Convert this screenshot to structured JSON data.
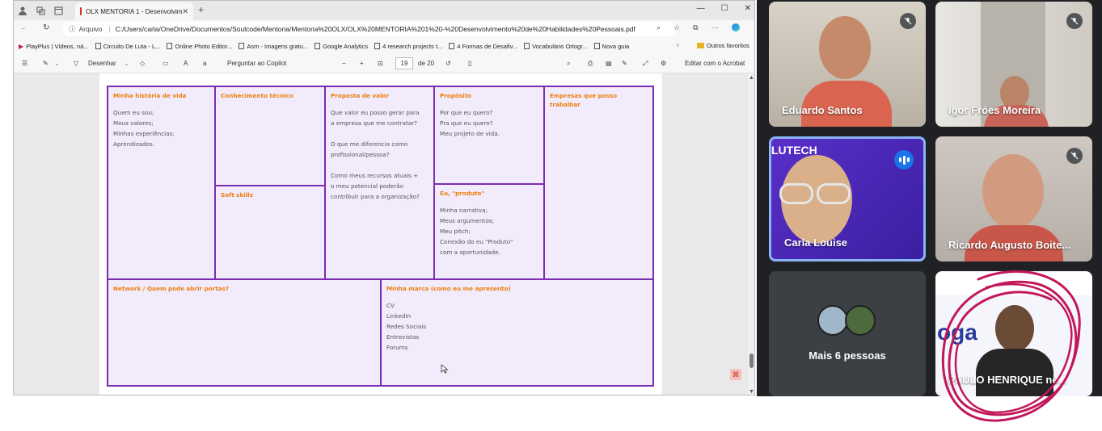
{
  "browser": {
    "tab_title": "OLX MENTORIA 1 - Desenvolvim",
    "address_prefix": "Arquivo",
    "url": "C:/Users/carla/OneDrive/Documentos/Soulcode/Mentoria/Mentoria%20OLX/OLX%20MENTORIA%201%20-%20Desenvolvimento%20de%20Habilidades%20Pessoais.pdf",
    "favorites": [
      "PlayPlus | Vídeos, ná...",
      "Circuito De Luta - L...",
      "Online Photo Editor...",
      "Asm - Imagens gratu...",
      "Google Analytics",
      "4 research projects t...",
      "4 Formas de Desafiv...",
      "Vocabulário Ortogr...",
      "Nova guia"
    ],
    "favorites_other": "Outros favoritos"
  },
  "pdf_toolbar": {
    "draw_label": "Desenhar",
    "copilot_label": "Perguntar ao Copilot",
    "page_current": "19",
    "page_total": "de 20",
    "acrobat_label": "Editar com o Acrobat"
  },
  "canvas": {
    "historia": {
      "title": "Minha história de vida",
      "lines": [
        "Quem eu sou;",
        "Meus valores;",
        "Minhas experiências;",
        "Aprendizados."
      ]
    },
    "conhecimento": {
      "title": "Conhecimento técnico"
    },
    "soft": {
      "title": "Soft skills"
    },
    "proposta": {
      "title": "Proposta de valor",
      "l1": "Que valor eu posso gerar para",
      "l2": "a empresa que me contratar?",
      "l3": "O que me diferencia como",
      "l4": "profissional/pessoa?",
      "l5": "Como meus recursos atuais +",
      "l6": "o meu potencial poderão",
      "l7": "contribuir para a organização?"
    },
    "proposito": {
      "title": "Propósito",
      "lines": [
        "Por que eu quero?",
        "Pra que eu quero?",
        "Meu projeto de vida."
      ]
    },
    "produto": {
      "title": "Eu, \"produto\"",
      "lines": [
        "Minha narrativa;",
        "Meus argumentos;",
        "Meu pitch;",
        "Conexão do eu \"Produto\"",
        "com a oportunidade."
      ]
    },
    "empresas": {
      "title": "Empresas que posso trabalhar"
    },
    "network": {
      "title": "Network / Quem pode abrir portas?"
    },
    "marca": {
      "title": "Minha marca (como eu me apresento)",
      "lines": [
        "CV",
        "LinkedIn",
        "Redes Sociais",
        "Entrevistas",
        "Forums"
      ]
    }
  },
  "meet": {
    "participants": [
      {
        "name": "Eduardo Santos",
        "muted": true
      },
      {
        "name": "Igor Fróes Moreira",
        "muted": true
      },
      {
        "name": "Carla Louise",
        "speaking": true
      },
      {
        "name": "Ricardo Augusto Boite...",
        "muted": true
      },
      {
        "name": "Mais 6 pessoas"
      },
      {
        "name": "PAULO HENRIQUE ne..."
      }
    ],
    "colors": {
      "speaking_ring": "#8ab4f8",
      "speaking_badge": "#1a73e8",
      "annotation": "#c2185b"
    }
  }
}
